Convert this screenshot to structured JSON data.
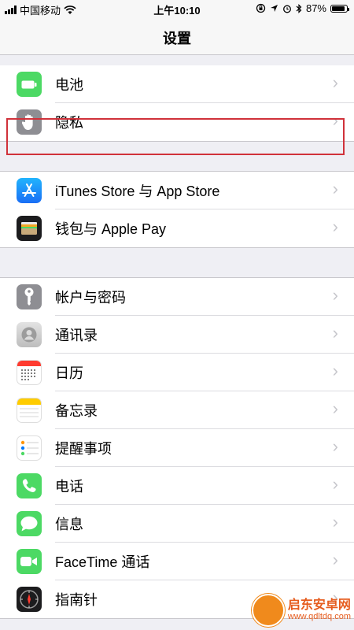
{
  "status_bar": {
    "carrier": "中国移动",
    "time": "上午10:10",
    "battery_percent": "87%",
    "battery_level": 0.87
  },
  "nav": {
    "title": "设置"
  },
  "groups": [
    [
      {
        "label": "电池",
        "icon": "battery-icon",
        "color": "#4cd964"
      },
      {
        "label": "隐私",
        "icon": "hand-icon",
        "color": "#8e8e93"
      }
    ],
    [
      {
        "label": "iTunes Store 与 App Store",
        "icon": "app-store-icon",
        "color": "#1e90ff"
      },
      {
        "label": "钱包与 Apple Pay",
        "icon": "wallet-icon",
        "color": "#1c1c1e"
      }
    ],
    [
      {
        "label": "帐户与密码",
        "icon": "key-icon",
        "color": "#8e8e93"
      },
      {
        "label": "通讯录",
        "icon": "contacts-icon",
        "color": "#c7c7cc"
      },
      {
        "label": "日历",
        "icon": "calendar-icon",
        "color": "#ffffff"
      },
      {
        "label": "备忘录",
        "icon": "notes-icon",
        "color": "#ffcc00"
      },
      {
        "label": "提醒事项",
        "icon": "reminders-icon",
        "color": "#ffffff"
      },
      {
        "label": "电话",
        "icon": "phone-icon",
        "color": "#4cd964"
      },
      {
        "label": "信息",
        "icon": "messages-icon",
        "color": "#4cd964"
      },
      {
        "label": "FaceTime 通话",
        "icon": "facetime-icon",
        "color": "#4cd964"
      },
      {
        "label": "指南针",
        "icon": "compass-icon",
        "color": "#1c1c1e"
      }
    ]
  ],
  "watermark": {
    "text": "启东安卓网",
    "url": "www.qdltdq.com"
  }
}
